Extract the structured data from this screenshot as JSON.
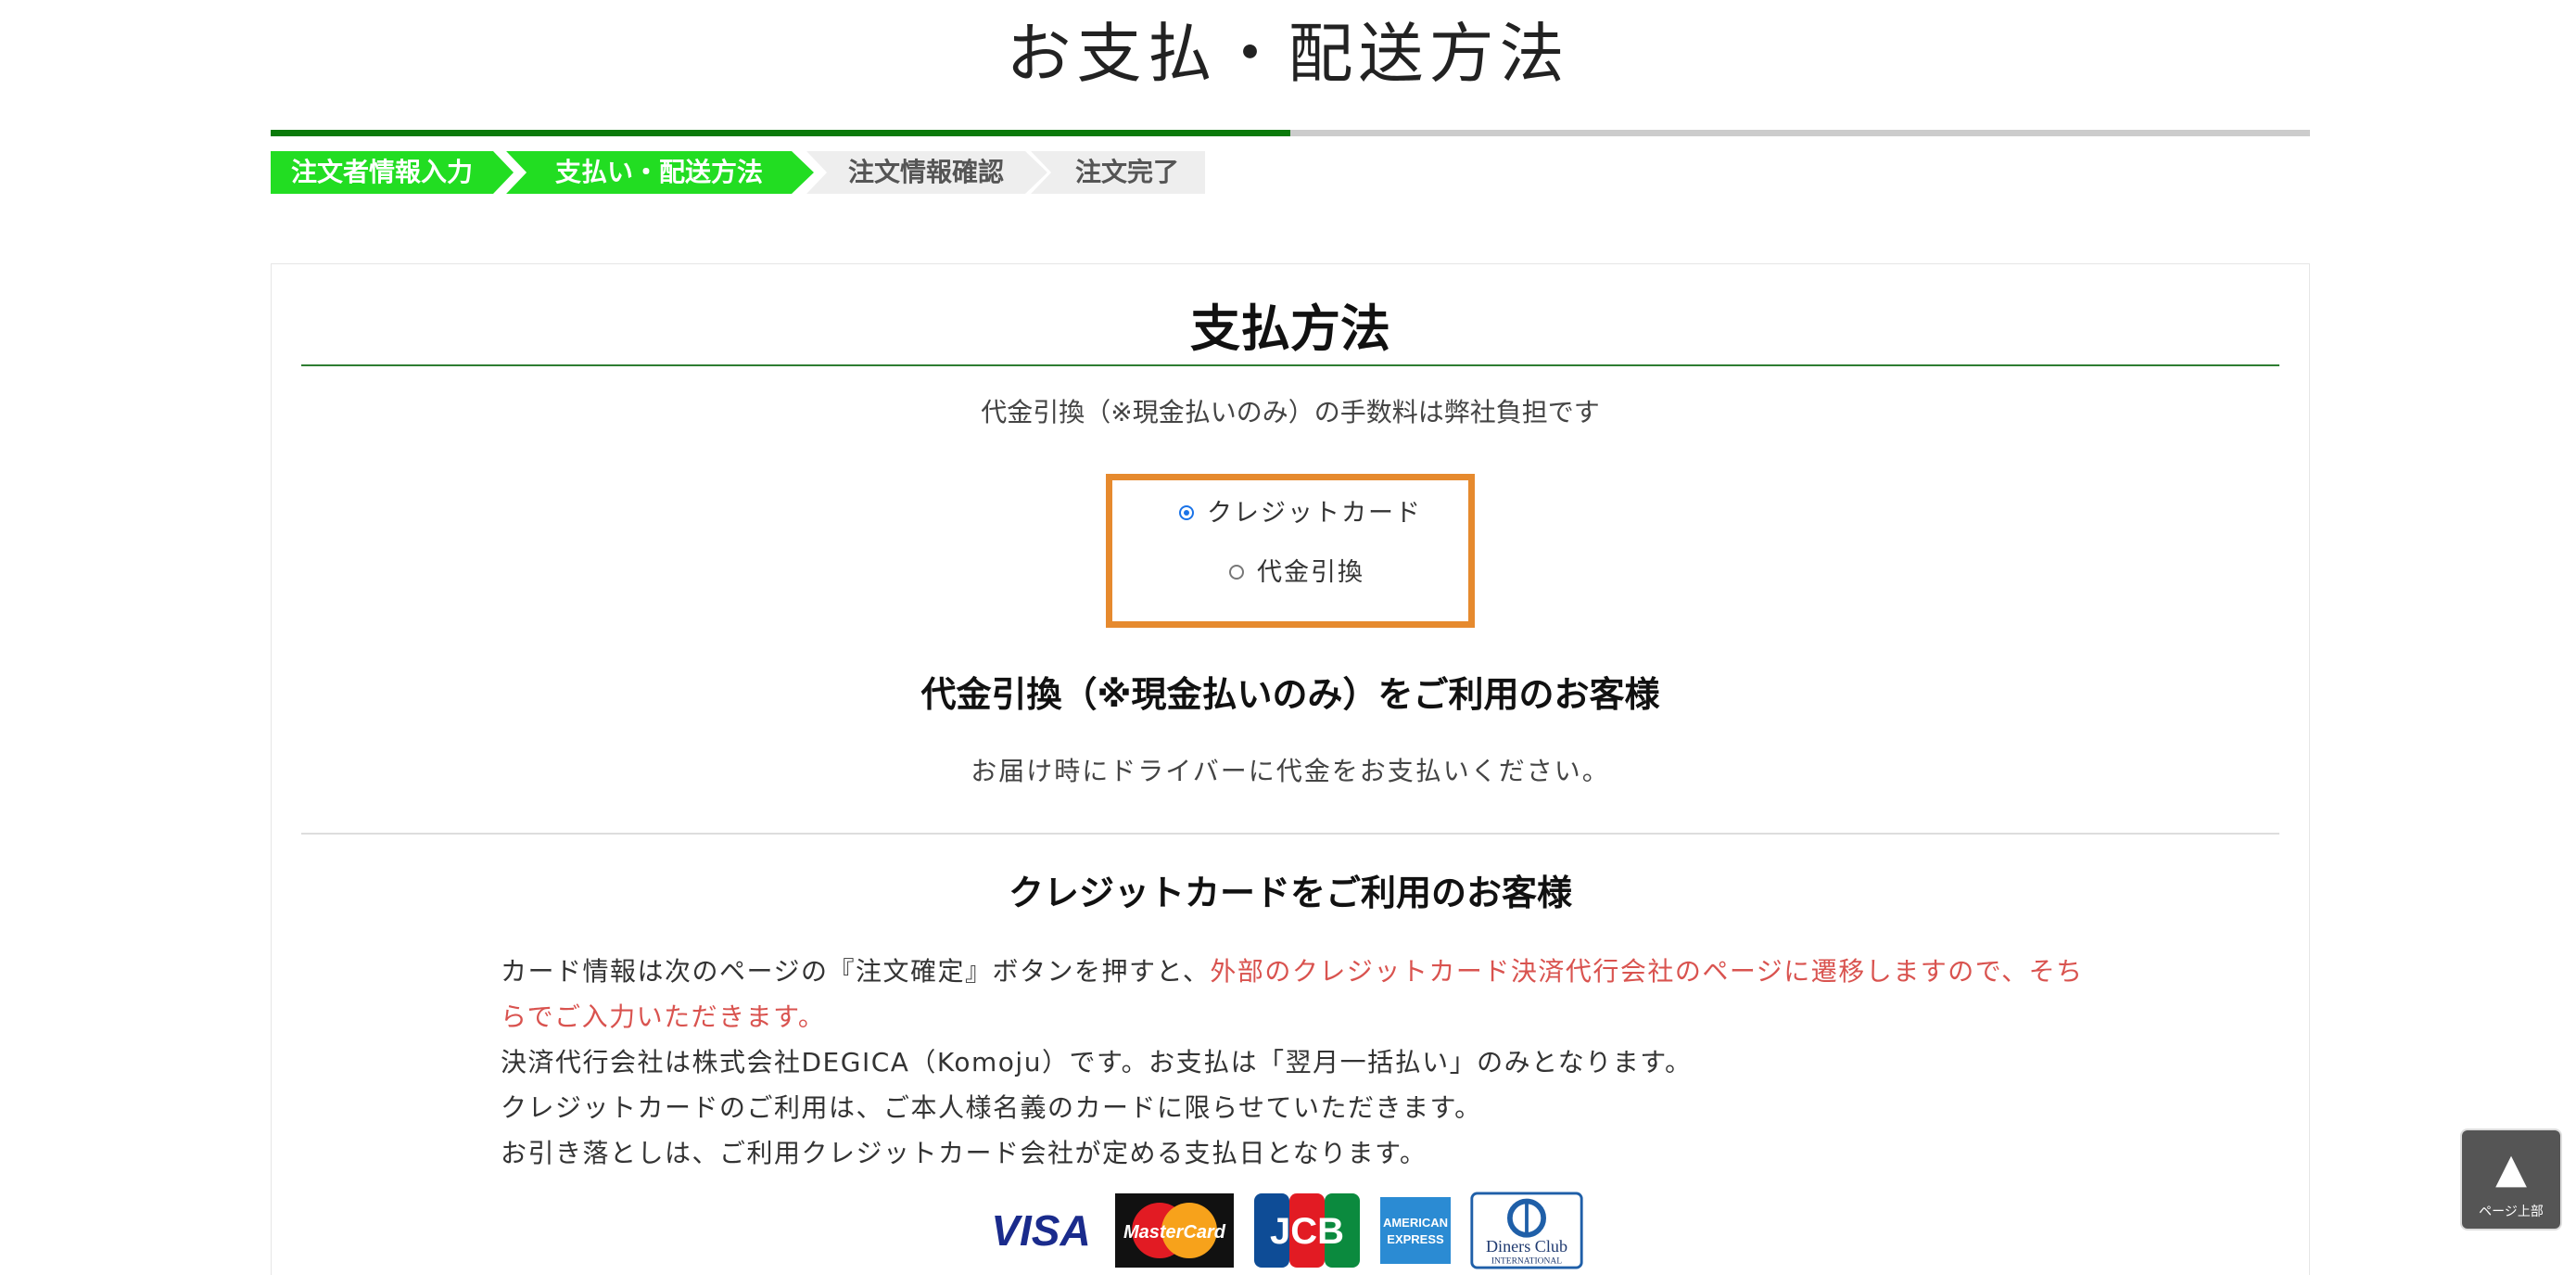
{
  "page": {
    "title": "お支払・配送方法"
  },
  "progress": {
    "percent": 50,
    "steps": [
      {
        "label": "注文者情報入力",
        "active": true
      },
      {
        "label": "支払い・配送方法",
        "active": true
      },
      {
        "label": "注文情報確認",
        "active": false
      },
      {
        "label": "注文完了",
        "active": false
      }
    ]
  },
  "payment": {
    "heading": "支払方法",
    "fee_note": "代金引換（※現金払いのみ）の手数料は弊社負担です",
    "options": [
      {
        "label": "クレジットカード",
        "checked": true
      },
      {
        "label": "代金引換",
        "checked": false
      }
    ],
    "cod": {
      "heading": "代金引換（※現金払いのみ）をご利用のお客様",
      "text": "お届け時にドライバーに代金をお支払いください。"
    },
    "card": {
      "heading": "クレジットカードをご利用のお客様",
      "line1_normal": "カード情報は次のページの『注文確定』ボタンを押すと、",
      "line1_red": "外部のクレジットカード決済代行会社のページに遷移しますので、そちらでご入力いただきます。",
      "line2": "決済代行会社は株式会社DEGICA（Komoju）です。お支払は「翌月一括払い」のみとなります。",
      "line3": "クレジットカードのご利用は、ご本人様名義のカードに限らせていただきます。",
      "line4": "お引き落としは、ご利用クレジットカード会社が定める支払日となります。"
    },
    "logos": [
      {
        "name": "VISA",
        "text": "VISA"
      },
      {
        "name": "MasterCard",
        "text": "MasterCard"
      },
      {
        "name": "JCB",
        "text": "JCB"
      },
      {
        "name": "American Express",
        "text1": "AMERICAN",
        "text2": "EXPRESS"
      },
      {
        "name": "Diners Club",
        "text1": "Diners Club",
        "text2": "INTERNATIONAL"
      }
    ]
  },
  "back_to_top": {
    "arrow": "▲",
    "label": "ページ上部"
  },
  "colors": {
    "step_active": "#22dd22",
    "step_inactive": "#eeeeee",
    "progress_fill": "#0a7a0a",
    "highlight_border": "#e68a2e",
    "red_text": "#d9534f"
  }
}
